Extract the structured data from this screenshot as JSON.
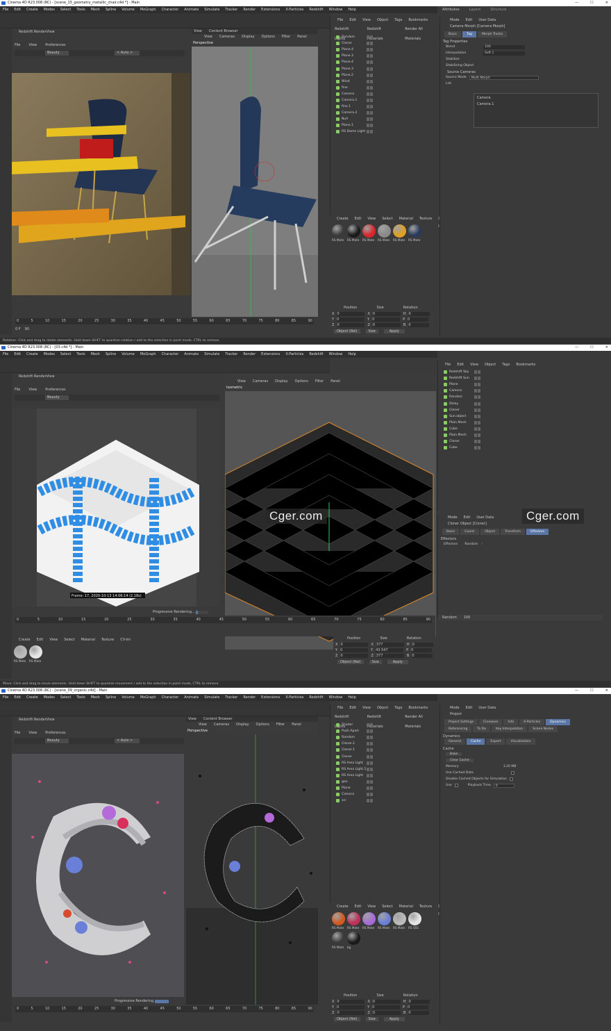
{
  "watermark": "Cger.com",
  "menu": [
    "File",
    "Edit",
    "Create",
    "Modes",
    "Select",
    "Tools",
    "Mesh",
    "Spline",
    "Volume",
    "MoGraph",
    "Character",
    "Animate",
    "Simulate",
    "Tracker",
    "Render",
    "Extensions",
    "X-Particles",
    "Redshift",
    "Window",
    "Help"
  ],
  "renderview": {
    "title": "Redshift RenderView",
    "menu": [
      "File",
      "View",
      "Preferences"
    ],
    "beauty": "Beauty",
    "auto": "< Auto >"
  },
  "viewport_menu": [
    "View",
    "Cameras",
    "Display",
    "Options",
    "Filter",
    "Panel"
  ],
  "om_menu": [
    "File",
    "Edit",
    "View",
    "Object",
    "Tags",
    "Bookmarks"
  ],
  "attr_menu": [
    "Mode",
    "Edit",
    "User Data"
  ],
  "mat_menu": [
    "Create",
    "Edit",
    "View",
    "Select",
    "Material",
    "Texture",
    "CV-Im"
  ],
  "coord_headers": [
    "Position",
    "Size",
    "Rotation"
  ],
  "coord_labels": [
    "X",
    "Y",
    "Z",
    "H",
    "P",
    "B"
  ],
  "buttons": {
    "object_rel": "Object (Rel)",
    "size": "Size",
    "apply": "Apply"
  },
  "rs_tabs": [
    "Redshift Lights",
    "Redshift Materials",
    "Render All Materials"
  ],
  "node_space": "Node Space:",
  "node_space_val": "Current (Redshift)",
  "layout": "Layout:",
  "layout_val": "redshift (User)",
  "panel1": {
    "title": "Cinema 4D R23.008 (RC) - [scene_15_geometry_metallic_chair.c4d *] - Main",
    "vp_label": "Perspective",
    "content_browser": "Content Browser",
    "objects": [
      "Random",
      "Cloner",
      "Plane.4",
      "Plane.3",
      "Plane.4",
      "Plane.3",
      "Plane.2",
      "Wind",
      "fine",
      "Camera",
      "Camera.1",
      "fine.1",
      "Camera.2",
      "Null",
      "Plane.1",
      "RS Dome Light"
    ],
    "materials": [
      "RS Mate",
      "RS Mate",
      "RS Mate",
      "RS Mate",
      "RS Mate",
      "RS Mate"
    ],
    "attr_title": "Camera Morph [Camera Morph]",
    "attr_tabs": [
      "Basic",
      "Tag",
      "Morph Tracks"
    ],
    "tag_props": "Tag Properties",
    "fields": [
      [
        "Blend",
        "100"
      ],
      [
        "Interpolation",
        "Soft 1"
      ],
      [
        "Stabilize",
        ""
      ],
      [
        "Stabilizing Object",
        ""
      ]
    ],
    "source_cams": "Source Cameras",
    "source_mode": "Source Mode",
    "source_mode_val": "Multi Morph",
    "list": "List",
    "cams": [
      "Camera",
      "Camera.1"
    ],
    "ticks": [
      "0",
      "5",
      "10",
      "15",
      "20",
      "25",
      "30",
      "35",
      "40",
      "45",
      "50",
      "55",
      "60",
      "65",
      "70",
      "75",
      "80",
      "85",
      "90"
    ],
    "frame_a": "0 F",
    "frame_b": "90",
    "status": "Rotation: Click and drag to rotate elements. Hold down SHIFT to quantize rotation / add to the selection in point mode, CTRL to remove."
  },
  "panel2": {
    "title": "Cinema 4D R23.008 (RC) - [03.c4d *] - Main",
    "vp_label": "Isometric",
    "objects": [
      "Redshift Sky",
      "Redshift Sun",
      "Plane",
      "Camera",
      "Random",
      "Delay",
      "Cloner",
      "Sun.object",
      "Plain.Mesh",
      "Cube",
      "Plain.Mesh",
      "Cloner",
      "Cube"
    ],
    "attr_title": "Cloner Object [Cloner]",
    "attr_tabs": [
      "Basic",
      "Coord.",
      "Object",
      "Transform",
      "Effectors"
    ],
    "effectors_head": "Effectors",
    "effectors": "Effectors",
    "effector_item": "Random",
    "random_label": "Random",
    "random_val": "100",
    "frame_info": "Frame: 17, 2020-10-13 14:06:14 (2.18s)",
    "progress": "Progressive Rendering...",
    "progress_val": 0.18,
    "materials": [
      "RS Mate",
      "RS Mate"
    ],
    "size_vals": [
      "377",
      "43.547",
      "377"
    ],
    "status": "Move: Click and drag to move elements. Hold down SHIFT to quantize movement / add to the selection in point mode, CTRL to remove."
  },
  "panel3": {
    "title": "Cinema 4D R23.008 (RC) - [scene_09_organic.c4d] - Main",
    "vp_label": "Perspective",
    "objects": [
      "Shader",
      "Push Apart",
      "Random",
      "Cloner.2",
      "Cloner.1",
      "Cloner",
      "RS Area Light",
      "RS Area Light.1",
      "RS Area Light",
      "geo",
      "Plane",
      "Camera",
      "src"
    ],
    "attr_title": "Project",
    "attr_tabs": [
      "Project Settings",
      "Cineware",
      "Info",
      "X-Particles",
      "Dynamics"
    ],
    "attr_tabs2": [
      "Referencing",
      "To Do",
      "Key Interpolation",
      "Scene Nodes"
    ],
    "dyn_head": "Dynamics",
    "dyn_tabs": [
      "General",
      "Cache",
      "Expert",
      "Visualization"
    ],
    "cache_head": "Cache",
    "bake": "Bake",
    "clear": "Clear Cache",
    "memory": "Memory",
    "memory_val": "3.20 MB",
    "use_cached": "Use Cached Data",
    "disable_cached": "Disable Cached Objects for Simulation",
    "use": "Use",
    "playback": "Playback Time",
    "playback_val": "0",
    "progress": "Progressive Rendering...",
    "materials": [
      "RS Mate",
      "RS Mate",
      "RS Mate",
      "RS Mate",
      "RS Mate",
      "RS SSS",
      "RS Mate",
      "bg"
    ]
  },
  "colors": {
    "accent": "#5a76a6",
    "orange": "#e08a2a",
    "blue": "#2f8de4",
    "red": "#d9252b",
    "green": "#49b04a"
  }
}
